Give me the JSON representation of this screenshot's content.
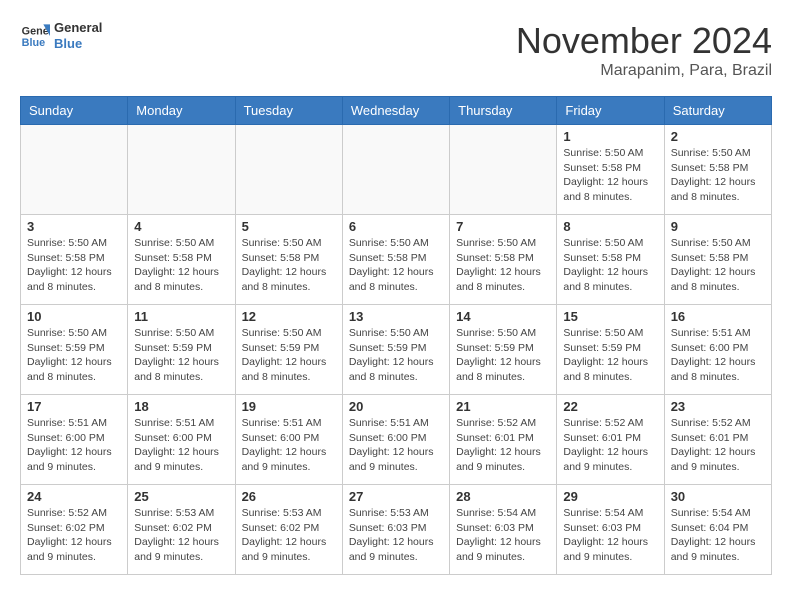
{
  "logo": {
    "text_general": "General",
    "text_blue": "Blue"
  },
  "title": {
    "month_year": "November 2024",
    "location": "Marapanim, Para, Brazil"
  },
  "weekdays": [
    "Sunday",
    "Monday",
    "Tuesday",
    "Wednesday",
    "Thursday",
    "Friday",
    "Saturday"
  ],
  "weeks": [
    [
      {
        "day": "",
        "info": ""
      },
      {
        "day": "",
        "info": ""
      },
      {
        "day": "",
        "info": ""
      },
      {
        "day": "",
        "info": ""
      },
      {
        "day": "",
        "info": ""
      },
      {
        "day": "1",
        "info": "Sunrise: 5:50 AM\nSunset: 5:58 PM\nDaylight: 12 hours\nand 8 minutes."
      },
      {
        "day": "2",
        "info": "Sunrise: 5:50 AM\nSunset: 5:58 PM\nDaylight: 12 hours\nand 8 minutes."
      }
    ],
    [
      {
        "day": "3",
        "info": "Sunrise: 5:50 AM\nSunset: 5:58 PM\nDaylight: 12 hours\nand 8 minutes."
      },
      {
        "day": "4",
        "info": "Sunrise: 5:50 AM\nSunset: 5:58 PM\nDaylight: 12 hours\nand 8 minutes."
      },
      {
        "day": "5",
        "info": "Sunrise: 5:50 AM\nSunset: 5:58 PM\nDaylight: 12 hours\nand 8 minutes."
      },
      {
        "day": "6",
        "info": "Sunrise: 5:50 AM\nSunset: 5:58 PM\nDaylight: 12 hours\nand 8 minutes."
      },
      {
        "day": "7",
        "info": "Sunrise: 5:50 AM\nSunset: 5:58 PM\nDaylight: 12 hours\nand 8 minutes."
      },
      {
        "day": "8",
        "info": "Sunrise: 5:50 AM\nSunset: 5:58 PM\nDaylight: 12 hours\nand 8 minutes."
      },
      {
        "day": "9",
        "info": "Sunrise: 5:50 AM\nSunset: 5:58 PM\nDaylight: 12 hours\nand 8 minutes."
      }
    ],
    [
      {
        "day": "10",
        "info": "Sunrise: 5:50 AM\nSunset: 5:59 PM\nDaylight: 12 hours\nand 8 minutes."
      },
      {
        "day": "11",
        "info": "Sunrise: 5:50 AM\nSunset: 5:59 PM\nDaylight: 12 hours\nand 8 minutes."
      },
      {
        "day": "12",
        "info": "Sunrise: 5:50 AM\nSunset: 5:59 PM\nDaylight: 12 hours\nand 8 minutes."
      },
      {
        "day": "13",
        "info": "Sunrise: 5:50 AM\nSunset: 5:59 PM\nDaylight: 12 hours\nand 8 minutes."
      },
      {
        "day": "14",
        "info": "Sunrise: 5:50 AM\nSunset: 5:59 PM\nDaylight: 12 hours\nand 8 minutes."
      },
      {
        "day": "15",
        "info": "Sunrise: 5:50 AM\nSunset: 5:59 PM\nDaylight: 12 hours\nand 8 minutes."
      },
      {
        "day": "16",
        "info": "Sunrise: 5:51 AM\nSunset: 6:00 PM\nDaylight: 12 hours\nand 8 minutes."
      }
    ],
    [
      {
        "day": "17",
        "info": "Sunrise: 5:51 AM\nSunset: 6:00 PM\nDaylight: 12 hours\nand 9 minutes."
      },
      {
        "day": "18",
        "info": "Sunrise: 5:51 AM\nSunset: 6:00 PM\nDaylight: 12 hours\nand 9 minutes."
      },
      {
        "day": "19",
        "info": "Sunrise: 5:51 AM\nSunset: 6:00 PM\nDaylight: 12 hours\nand 9 minutes."
      },
      {
        "day": "20",
        "info": "Sunrise: 5:51 AM\nSunset: 6:00 PM\nDaylight: 12 hours\nand 9 minutes."
      },
      {
        "day": "21",
        "info": "Sunrise: 5:52 AM\nSunset: 6:01 PM\nDaylight: 12 hours\nand 9 minutes."
      },
      {
        "day": "22",
        "info": "Sunrise: 5:52 AM\nSunset: 6:01 PM\nDaylight: 12 hours\nand 9 minutes."
      },
      {
        "day": "23",
        "info": "Sunrise: 5:52 AM\nSunset: 6:01 PM\nDaylight: 12 hours\nand 9 minutes."
      }
    ],
    [
      {
        "day": "24",
        "info": "Sunrise: 5:52 AM\nSunset: 6:02 PM\nDaylight: 12 hours\nand 9 minutes."
      },
      {
        "day": "25",
        "info": "Sunrise: 5:53 AM\nSunset: 6:02 PM\nDaylight: 12 hours\nand 9 minutes."
      },
      {
        "day": "26",
        "info": "Sunrise: 5:53 AM\nSunset: 6:02 PM\nDaylight: 12 hours\nand 9 minutes."
      },
      {
        "day": "27",
        "info": "Sunrise: 5:53 AM\nSunset: 6:03 PM\nDaylight: 12 hours\nand 9 minutes."
      },
      {
        "day": "28",
        "info": "Sunrise: 5:54 AM\nSunset: 6:03 PM\nDaylight: 12 hours\nand 9 minutes."
      },
      {
        "day": "29",
        "info": "Sunrise: 5:54 AM\nSunset: 6:03 PM\nDaylight: 12 hours\nand 9 minutes."
      },
      {
        "day": "30",
        "info": "Sunrise: 5:54 AM\nSunset: 6:04 PM\nDaylight: 12 hours\nand 9 minutes."
      }
    ]
  ]
}
